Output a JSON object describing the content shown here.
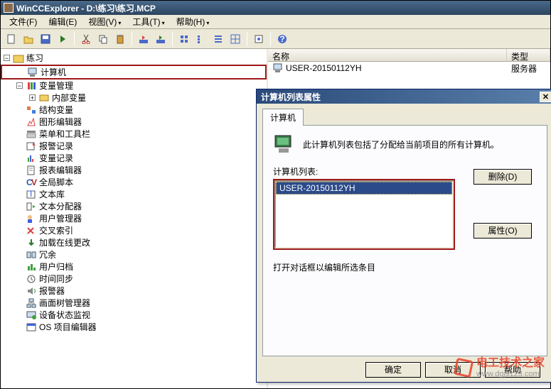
{
  "title": "WinCCExplorer - D:\\练习\\练习.MCP",
  "menus": [
    "文件(F)",
    "编辑(E)",
    "视图(V)",
    "工具(T)",
    "帮助(H)"
  ],
  "tree": {
    "root": "练习",
    "nodes": [
      "计算机",
      "变量管理",
      "内部变量",
      "结构变量",
      "图形编辑器",
      "菜单和工具栏",
      "报警记录",
      "变量记录",
      "报表编辑器",
      "全局脚本",
      "文本库",
      "文本分配器",
      "用户管理器",
      "交叉索引",
      "加载在线更改",
      "冗余",
      "用户归档",
      "时间同步",
      "报警器",
      "画面树管理器",
      "设备状态监视",
      "OS 项目编辑器"
    ]
  },
  "list": {
    "cols": [
      "名称",
      "类型"
    ],
    "row": {
      "name": "USER-20150112YH",
      "type": "服务器"
    }
  },
  "dialog": {
    "title": "计算机列表属性",
    "tab": "计算机",
    "info": "此计算机列表包括了分配给当前项目的所有计算机。",
    "listLabel": "计算机列表:",
    "item": "USER-20150112YH",
    "btnDelete": "删除(D)",
    "btnProps": "属性(O)",
    "hint": "打开对话框以编辑所选条目",
    "ok": "确定",
    "cancel": "取消",
    "help": "帮助"
  },
  "watermark": {
    "name": "电工技术之家",
    "url": "www.dgjs123.com"
  }
}
